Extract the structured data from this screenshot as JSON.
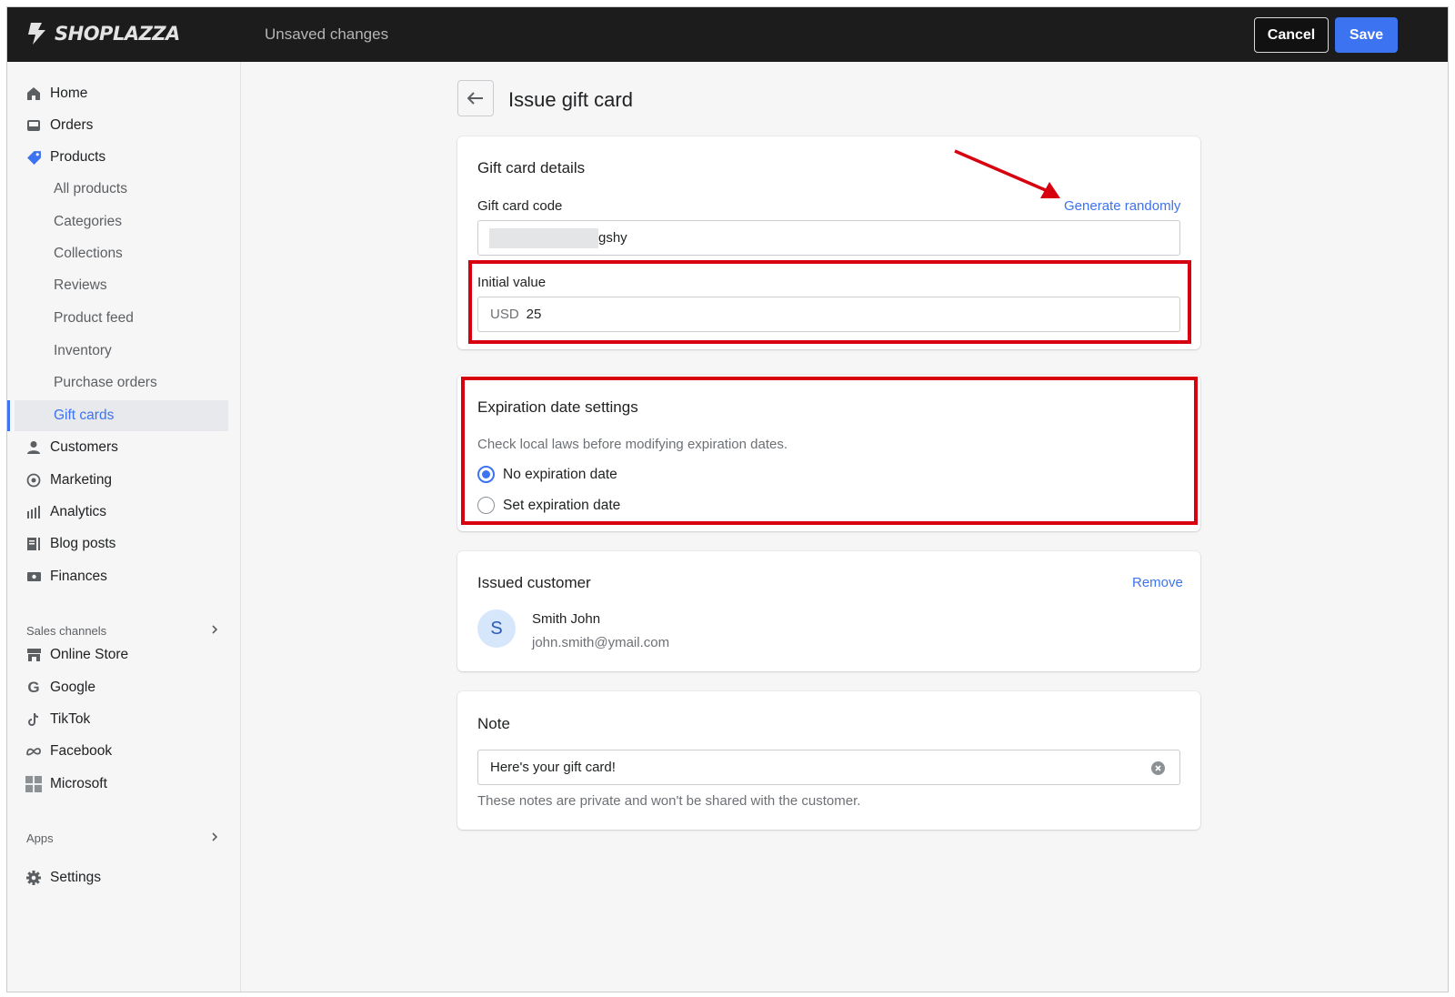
{
  "app": {
    "brand": "SHOPLAZZA",
    "status": "Unsaved changes"
  },
  "header": {
    "cancel_label": "Cancel",
    "save_label": "Save"
  },
  "sidebar": {
    "items": [
      {
        "label": "Home",
        "icon": "home-icon"
      },
      {
        "label": "Orders",
        "icon": "inbox-icon"
      },
      {
        "label": "Products",
        "icon": "tag-icon"
      },
      {
        "label": "All products"
      },
      {
        "label": "Categories"
      },
      {
        "label": "Collections"
      },
      {
        "label": "Reviews"
      },
      {
        "label": "Product feed"
      },
      {
        "label": "Inventory"
      },
      {
        "label": "Purchase orders"
      },
      {
        "label": "Gift cards",
        "active": true
      },
      {
        "label": "Customers",
        "icon": "person-icon"
      },
      {
        "label": "Marketing",
        "icon": "target-icon"
      },
      {
        "label": "Analytics",
        "icon": "bar-chart-icon"
      },
      {
        "label": "Blog posts",
        "icon": "blog-icon"
      },
      {
        "label": "Finances",
        "icon": "finance-icon"
      }
    ],
    "sales_channels_label": "Sales channels",
    "channels": [
      {
        "label": "Online Store",
        "icon": "store-icon"
      },
      {
        "label": "Google",
        "icon": "google-icon"
      },
      {
        "label": "TikTok",
        "icon": "tiktok-icon"
      },
      {
        "label": "Facebook",
        "icon": "meta-icon"
      },
      {
        "label": "Microsoft",
        "icon": "microsoft-icon"
      }
    ],
    "apps_label": "Apps",
    "settings_label": "Settings"
  },
  "page": {
    "title": "Issue gift card"
  },
  "gift_card": {
    "title": "Gift card details",
    "code_label": "Gift card code",
    "generate_label": "Generate randomly",
    "code_value": "gshy",
    "initial_value_label": "Initial value",
    "currency": "USD",
    "initial_value": "25"
  },
  "expiration": {
    "title": "Expiration date settings",
    "hint": "Check local laws before modifying expiration dates.",
    "option_none": "No expiration date",
    "option_set": "Set expiration date",
    "selected": "none"
  },
  "customer": {
    "title": "Issued customer",
    "remove_label": "Remove",
    "initial": "S",
    "name": "Smith John",
    "email": "john.smith@ymail.com"
  },
  "note": {
    "title": "Note",
    "value": "Here's your gift card!",
    "help": "These notes are private and won't be shared with the customer."
  },
  "colors": {
    "accent": "#3b73f0",
    "highlight": "#d6000f",
    "topbar": "#1c1c1c"
  }
}
